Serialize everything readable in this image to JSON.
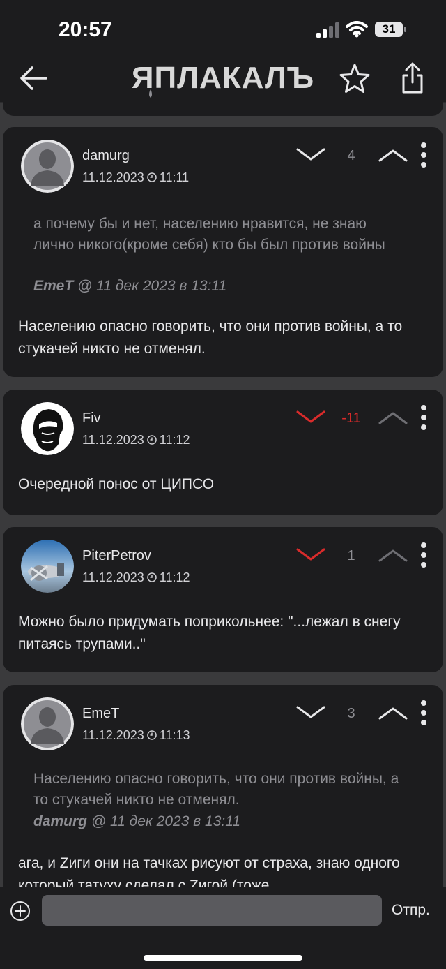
{
  "status": {
    "time": "20:57",
    "battery": "31"
  },
  "nav": {
    "logo_text": "ЯПЛАКАЛЪ"
  },
  "comments": [
    {
      "username": "damurg",
      "date": "11.12.2023",
      "time": "11:11",
      "score": "4",
      "downvoted": false,
      "quote_text": "а почему бы и нет, населению нравится, не знаю лично никого(кроме себя) кто бы был против войны",
      "quote_author": "EmeT",
      "quote_meta": "@ 11 дек 2023 в 13:11",
      "text": "Населению опасно говорить, что они против войны, а то стукачей никто не отменял."
    },
    {
      "username": "Fiv",
      "date": "11.12.2023",
      "time": "11:12",
      "score": "-11",
      "downvoted": true,
      "text": "Очередной понос от ЦИПСО"
    },
    {
      "username": "PiterPetrov",
      "date": "11.12.2023",
      "time": "11:12",
      "score": "1",
      "downvoted": true,
      "text": "Можно было придумать поприкольнее: \"...лежал в снегу питаясь трупами..\""
    },
    {
      "username": "EmeT",
      "date": "11.12.2023",
      "time": "11:13",
      "score": "3",
      "downvoted": false,
      "quote_text": "Населению опасно говорить, что они против войны, а то стукачей никто не отменял.",
      "quote_author": "damurg",
      "quote_meta": "@ 11 дек 2023 в 13:11",
      "text": "ага, и Zиги они на тачках рисуют от страха, знаю одного который татуху сделал с Zигой (тоже"
    }
  ],
  "composer": {
    "placeholder": "",
    "send_label": "Отпр."
  },
  "colors": {
    "card": "#1c1c1e",
    "background": "#3a3a3c",
    "downvote": "#d92b2b",
    "muted": "#8e8e93"
  }
}
